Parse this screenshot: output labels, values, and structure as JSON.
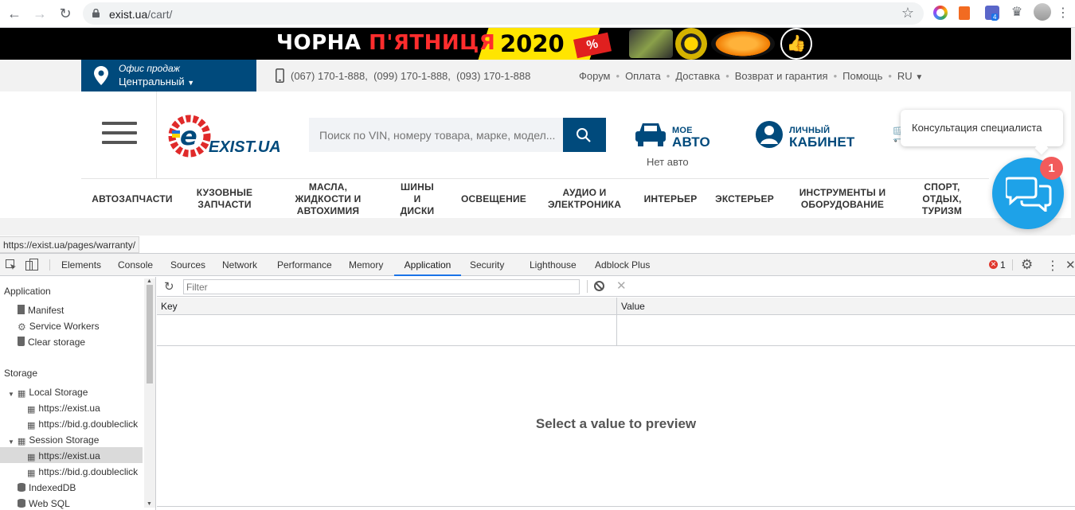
{
  "browser": {
    "url_host": "exist.ua",
    "url_path": "/cart/",
    "extension_badge": "4"
  },
  "banner": {
    "text_white": "ЧОРНА ",
    "text_red": "П'ЯТНИЦЯ",
    "year": "2020",
    "discount_tag": "%"
  },
  "topbar": {
    "office_label": "Офис продаж",
    "office_value": "Центральный",
    "phones": "(067) 170-1-888,  (099) 170-1-888,  (093) 170-1-888",
    "nav": [
      "Форум",
      "Оплата",
      "Доставка",
      "Возврат и гарантия",
      "Помощь",
      "RU"
    ]
  },
  "header": {
    "logo_text": "EXIST.UA",
    "search_placeholder": "Поиск по VIN, номеру товара, марке, модел...",
    "car_small": "МОЕ",
    "car_big": "АВТО",
    "car_status": "Нет авто",
    "cabinet_small": "ЛИЧНЫЙ",
    "cabinet_big": "КАБИНЕТ"
  },
  "categories": [
    "АВТОЗАПЧАСТИ",
    "КУЗОВНЫЕ\nЗАПЧАСТИ",
    "МАСЛА,\nЖИДКОСТИ И\nАВТОХИМИЯ",
    "ШИНЫ\nИ\nДИСКИ",
    "ОСВЕЩЕНИЕ",
    "АУДИО И\nЭЛЕКТРОНИКА",
    "ИНТЕРЬЕР",
    "ЭКСТЕРЬЕР",
    "ИНСТРУМЕНТЫ И\nОБОРУДОВАНИЕ",
    "СПОРТ,\nОТДЫХ,\nТУРИЗМ"
  ],
  "chat": {
    "tooltip": "Консультация специалиста",
    "badge": "1"
  },
  "status_url": "https://exist.ua/pages/warranty/",
  "devtools": {
    "tabs": [
      "Elements",
      "Console",
      "Sources",
      "Network",
      "Performance",
      "Memory",
      "Application",
      "Security",
      "Lighthouse",
      "Adblock Plus"
    ],
    "active_tab": "Application",
    "error_count": "1",
    "sidebar": {
      "application_header": "Application",
      "application_items": [
        "Manifest",
        "Service Workers",
        "Clear storage"
      ],
      "storage_header": "Storage",
      "local_storage": "Local Storage",
      "local_items": [
        "https://exist.ua",
        "https://bid.g.doubleclick"
      ],
      "session_storage": "Session Storage",
      "session_items": [
        "https://exist.ua",
        "https://bid.g.doubleclick"
      ],
      "indexeddb": "IndexedDB",
      "websql": "Web SQL"
    },
    "filter_placeholder": "Filter",
    "table_key": "Key",
    "table_value": "Value",
    "preview_text": "Select a value to preview"
  },
  "colors": {
    "brand_blue": "#004a7c",
    "chat_blue": "#1ea2e8",
    "badge_red": "#f25b5b",
    "banner_yellow": "#ffe500",
    "devtools_active": "#1a73e8"
  }
}
